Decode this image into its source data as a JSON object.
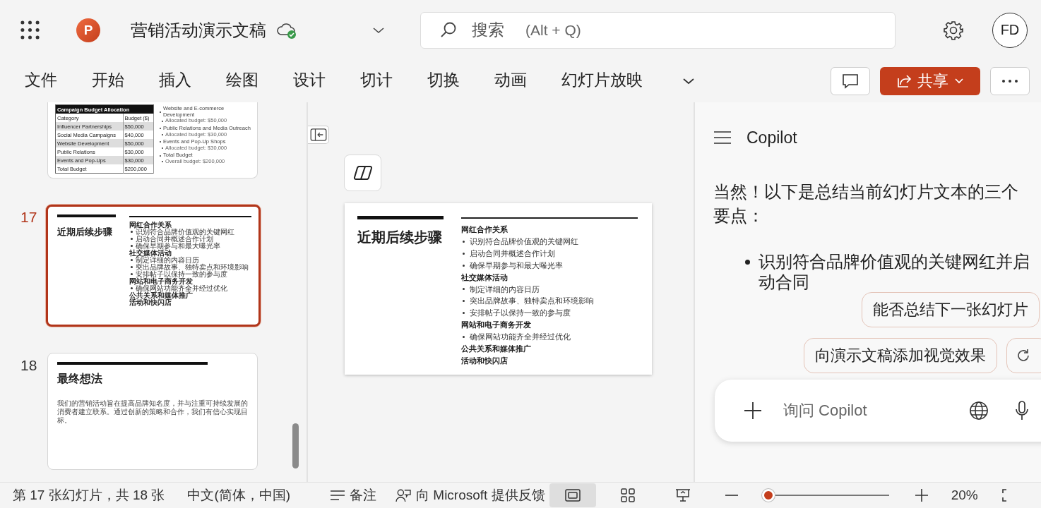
{
  "app_bar": {
    "logo_letter": "P",
    "title": "营销活动演示文稿",
    "search": {
      "placeholder": "搜索",
      "shortcut": "(Alt + Q)"
    },
    "avatar": "FD"
  },
  "ribbon": {
    "tabs": [
      {
        "label": "文件",
        "selected": false
      },
      {
        "label": "开始",
        "selected": false
      },
      {
        "label": "插入",
        "selected": false
      },
      {
        "label": "绘图",
        "selected": false
      },
      {
        "label": "设计",
        "selected": false
      },
      {
        "label": "切计",
        "selected": false
      },
      {
        "label": "切换",
        "selected": false
      },
      {
        "label": "动画",
        "selected": false
      },
      {
        "label": "幻灯片放映",
        "selected": false
      }
    ],
    "share": "共享"
  },
  "slides": [
    {
      "kind": "budget",
      "selected": false,
      "table_title": "Campaign Budget Allocation",
      "table_rows": [
        [
          "Category",
          "Budget ($)"
        ],
        [
          "Influencer Partnerships",
          "$50,000"
        ],
        [
          "Social Media Campaigns",
          "$40,000"
        ],
        [
          "Website Development",
          "$50,000"
        ],
        [
          "Public Relations",
          "$30,000"
        ],
        [
          "Events and Pop-Ups",
          "$30,000"
        ],
        [
          "Total Budget",
          "$200,000"
        ]
      ],
      "bullets": [
        {
          "text": "Website and E-commerce Development",
          "sub": false
        },
        {
          "text": "Allocated budget: $50,000",
          "sub": true
        },
        {
          "text": "Public Relations and Media Outreach",
          "sub": false
        },
        {
          "text": "Allocated budget: $30,000",
          "sub": true
        },
        {
          "text": "Events and Pop-Up Shops",
          "sub": false
        },
        {
          "text": "Allocated budget: $30,000",
          "sub": true
        },
        {
          "text": "Total Budget",
          "sub": false
        },
        {
          "text": "Overall budget: $200,000",
          "sub": true
        }
      ]
    },
    {
      "kind": "steps",
      "number": "17",
      "selected": true,
      "title": "近期后续步骤",
      "sections": [
        {
          "heading": "网红合作关系",
          "bullets": [
            "识别符合品牌价值观的关键网红",
            "启动合同并概述合作计划",
            "确保早期参与和最大曝光率"
          ]
        },
        {
          "heading": "社交媒体活动",
          "bullets": [
            "制定详细的内容日历",
            "突出品牌故事、独特卖点和环境影响",
            "安排帖子以保持一致的参与度"
          ]
        },
        {
          "heading": "网站和电子商务开发",
          "bullets": [
            "确保网站功能齐全并经过优化"
          ]
        },
        {
          "heading": "公共关系和媒体推广"
        },
        {
          "heading": "活动和快闪店"
        }
      ]
    },
    {
      "kind": "closing",
      "number": "18",
      "selected": false,
      "title": "最终想法",
      "body": "我们的营销活动旨在提高品牌知名度，并与注重可持续发展的消费者建立联系。通过创新的策略和合作，我们有信心实现目标。"
    }
  ],
  "editor": {
    "slide": {
      "title": "近期后续步骤",
      "sections": [
        {
          "heading": "网红合作关系",
          "bullets": [
            "识别符合品牌价值观的关键网红",
            "启动合同并概述合作计划",
            "确保早期参与和最大曝光率"
          ]
        },
        {
          "heading": "社交媒体活动",
          "bullets": [
            "制定详细的内容日历",
            "突出品牌故事、独特卖点和环境影响",
            "安排帖子以保持一致的参与度"
          ]
        },
        {
          "heading": "网站和电子商务开发",
          "bullets": [
            "确保网站功能齐全并经过优化"
          ]
        },
        {
          "heading": "公共关系和媒体推广"
        },
        {
          "heading": "活动和快闪店"
        }
      ]
    }
  },
  "copilot": {
    "title": "Copilot",
    "message": "当然！以下是总结当前幻灯片文本的三个要点：",
    "bullets": [
      "识别符合品牌价值观的关键网红并启动合同"
    ],
    "suggestions": [
      "能否总结下一张幻灯片",
      "向演示文稿添加视觉效果"
    ],
    "input_placeholder": "询问 Copilot"
  },
  "status_bar": {
    "slide_position": "第 17 张幻灯片，共 18 张",
    "language": "中文(简体，中国)",
    "notes": "备注",
    "feedback": "向 Microsoft 提供反馈",
    "views": [
      {
        "kind": "normal",
        "selected": true
      },
      {
        "kind": "sorter",
        "selected": false
      },
      {
        "kind": "presenter",
        "selected": false
      }
    ],
    "zoom": {
      "level": 0.05,
      "reading": "20%"
    }
  }
}
